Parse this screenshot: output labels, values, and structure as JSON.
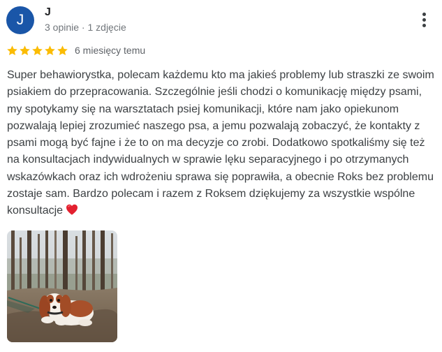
{
  "author": {
    "initial": "J",
    "name": "J",
    "meta": "3 opinie · 1 zdjęcie",
    "avatar_color": "#1a56a8"
  },
  "menu_icon": "more-vertical-icon",
  "rating": {
    "stars": 5,
    "max_stars": 5,
    "star_color": "#fbbc04",
    "date": "6 miesięcy temu"
  },
  "review": {
    "text": "Super behawiorystka, polecam każdemu kto ma jakieś problemy lub straszki ze swoim psiakiem do przepracowania. Szczególnie jeśli chodzi o komunikację między psami, my spotykamy się na warsztatach psiej komunikacji, które nam jako opiekunom pozwalają lepiej zrozumieć naszego psa, a jemu pozwalają zobaczyć, że kontakty z psami mogą być fajne i że to on ma decyzje co zrobi. Dodatkowo spotkaliśmy się też na konsultacjach indywidualnych w sprawie lęku separacyjnego i po otrzymanych wskazówkach oraz ich wdrożeniu sprawa się poprawiła, a obecnie Roks bez problemu zostaje sam. Bardzo polecam i razem z Roksem dziękujemy za wszystkie wspólne konsultacje",
    "emoji": "red-heart-icon"
  },
  "photo": {
    "subject": "dog-in-forest-photo"
  }
}
